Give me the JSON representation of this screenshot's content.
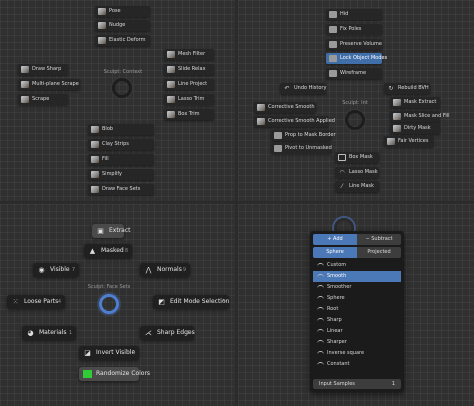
{
  "q1": {
    "pie_title": "Sculpt: Context",
    "items": [
      {
        "id": "pose",
        "label": "Pose"
      },
      {
        "id": "nudge",
        "label": "Nudge"
      },
      {
        "id": "elastic-deform",
        "label": "Elastic Deform"
      },
      {
        "id": "mesh-filter",
        "label": "Mesh Filter"
      },
      {
        "id": "draw-sharp",
        "label": "Draw Sharp"
      },
      {
        "id": "slide-relax",
        "label": "Slide Relax"
      },
      {
        "id": "multi-plane-scrape",
        "label": "Multi-plane Scrape"
      },
      {
        "id": "line-project",
        "label": "Line Project"
      },
      {
        "id": "scrape",
        "label": "Scrape"
      },
      {
        "id": "lasso-trim",
        "label": "Lasso Trim"
      },
      {
        "id": "box-trim",
        "label": "Box Trim"
      },
      {
        "id": "blob",
        "label": "Blob"
      },
      {
        "id": "clay-strips",
        "label": "Clay Strips"
      },
      {
        "id": "fill",
        "label": "Fill"
      },
      {
        "id": "simplify",
        "label": "Simplify"
      },
      {
        "id": "draw-face-sets",
        "label": "Draw Face Sets"
      }
    ]
  },
  "q2": {
    "pie_title": "Sculpt: Int",
    "items": [
      {
        "id": "hide",
        "label": "Hid"
      },
      {
        "id": "fix-poles",
        "label": "Fix Poles"
      },
      {
        "id": "preserve-volume",
        "label": "Preserve Volume"
      },
      {
        "id": "lock-object-modes",
        "label": "Lock Object Modes"
      },
      {
        "id": "wireframe",
        "label": "Wireframe"
      },
      {
        "id": "undo-history",
        "label": "Undo History"
      },
      {
        "id": "rebuild-bvh",
        "label": "Rebuild BVH"
      },
      {
        "id": "mask-extract",
        "label": "Mask Extract"
      },
      {
        "id": "corrective-smooth",
        "label": "Corrective Smooth"
      },
      {
        "id": "mask-slice-fill",
        "label": "Mask Slice and Fill"
      },
      {
        "id": "corrective-smooth-applied",
        "label": "Corrective Smooth Applied"
      },
      {
        "id": "dirty-mask",
        "label": "Dirty Mask"
      },
      {
        "id": "prop-mask-border",
        "label": "Prop to Mask Border"
      },
      {
        "id": "pivot-unmasked",
        "label": "Pivot to Unmasked"
      },
      {
        "id": "fair-vertices",
        "label": "Fair Vertices"
      },
      {
        "id": "box-mask",
        "label": "Box Mask"
      },
      {
        "id": "lasso-mask",
        "label": "Lasso Mask"
      },
      {
        "id": "line-mask",
        "label": "Line Mask"
      }
    ]
  },
  "q3": {
    "pie_title": "Sculpt: Face Sets",
    "items": [
      {
        "id": "extract",
        "label": "Extract",
        "key": ""
      },
      {
        "id": "masked",
        "label": "Masked",
        "key": "8"
      },
      {
        "id": "visible",
        "label": "Visible",
        "key": "7"
      },
      {
        "id": "normals",
        "label": "Normals",
        "key": "9"
      },
      {
        "id": "loose-parts",
        "label": "Loose Parts",
        "key": "4"
      },
      {
        "id": "edit-mode-selection",
        "label": "Edit Mode Selection",
        "key": "6"
      },
      {
        "id": "materials",
        "label": "Materials",
        "key": "1"
      },
      {
        "id": "sharp-edges",
        "label": "Sharp Edges",
        "key": "3"
      },
      {
        "id": "invert-visible",
        "label": "Invert Visible",
        "key": "2"
      },
      {
        "id": "randomize-colors",
        "label": "Randomize Colors",
        "key": ""
      }
    ]
  },
  "q4": {
    "mode": {
      "add": "Add",
      "subtract": "Subtract",
      "active": "add"
    },
    "shape": {
      "sphere": "Sphere",
      "projected": "Projected",
      "active": "sphere"
    },
    "falloffs": [
      "Custom",
      "Smooth",
      "Smoother",
      "Sphere",
      "Root",
      "Sharp",
      "Linear",
      "Sharper",
      "Inverse square",
      "Constant"
    ],
    "selected_falloff": "Smooth",
    "samples_label": "Input Samples",
    "samples_value": "1"
  },
  "colors": {
    "accent": "#4b78b7",
    "bg": "#303030",
    "button": "#262626",
    "green": "#2fcc36"
  }
}
